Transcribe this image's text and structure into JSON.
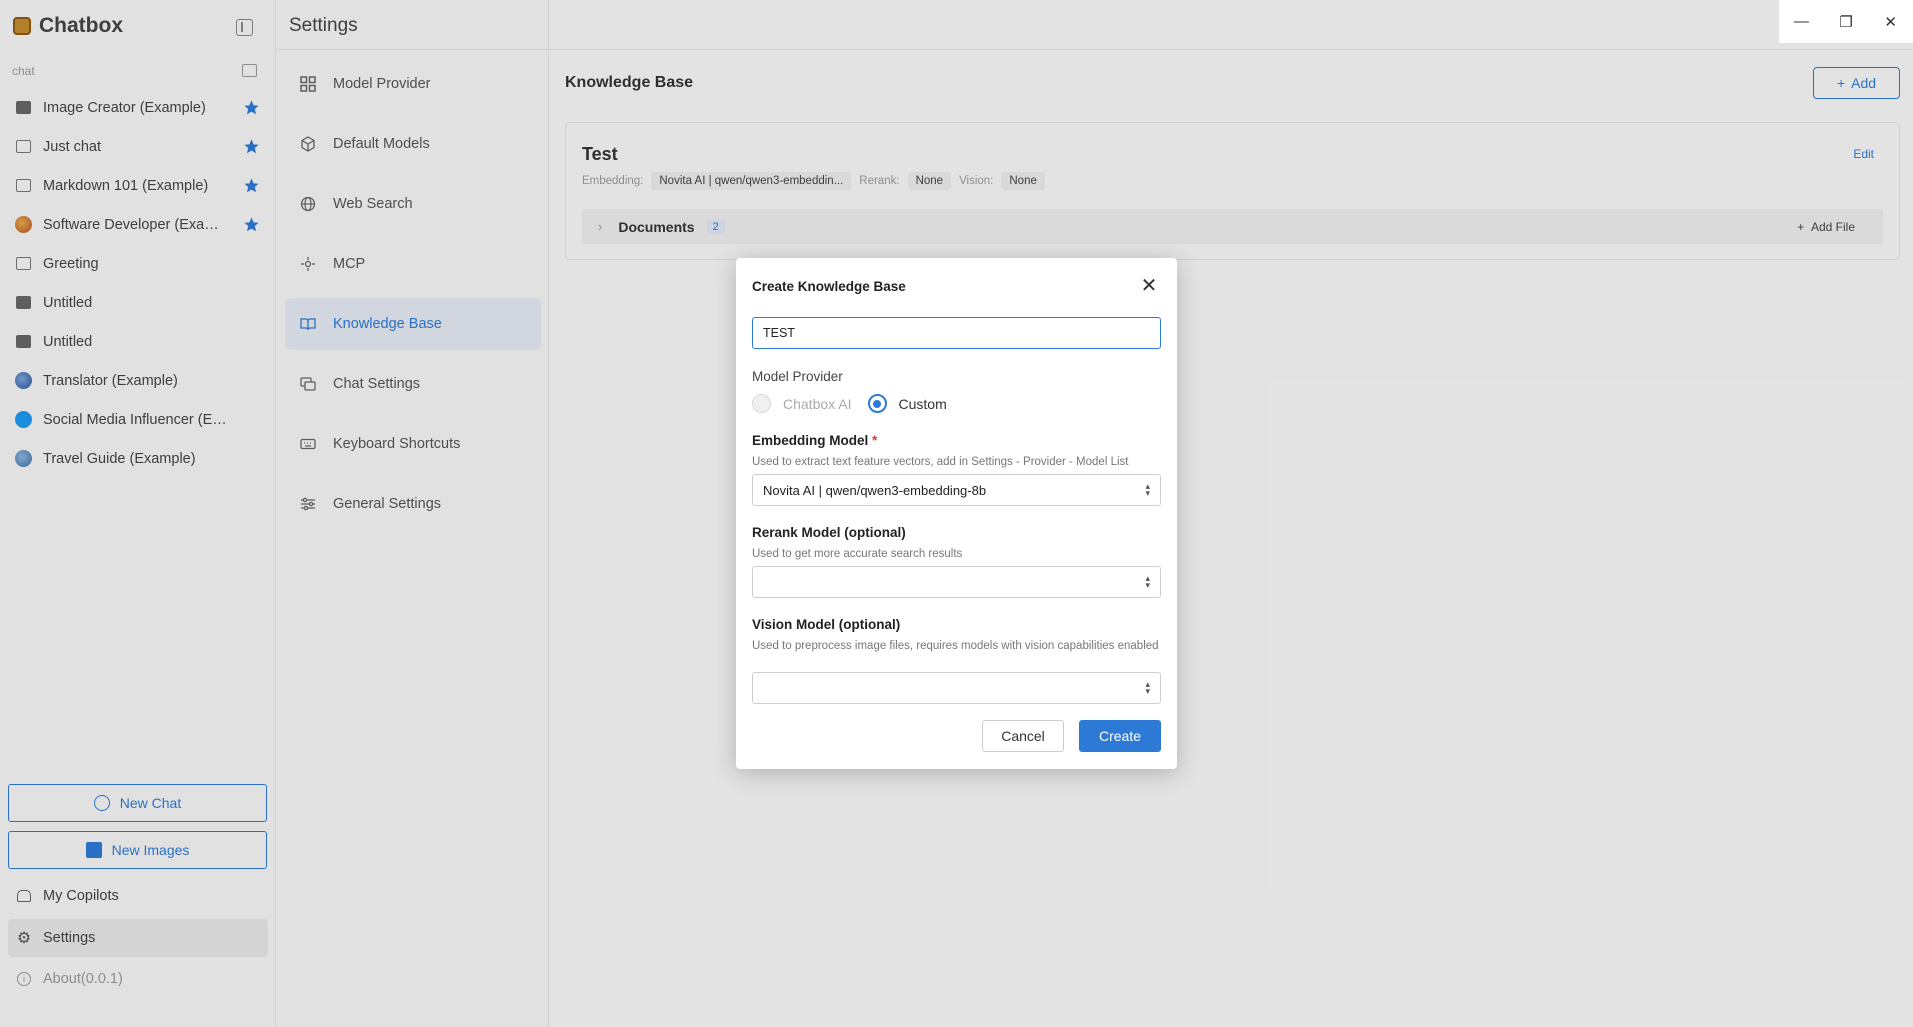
{
  "app": {
    "name": "Chatbox"
  },
  "sidebar": {
    "section_label": "chat",
    "chats": [
      {
        "label": "Image Creator (Example)",
        "icon": "image-icon",
        "starred": true
      },
      {
        "label": "Just chat",
        "icon": "message-icon",
        "starred": true
      },
      {
        "label": "Markdown 101 (Example)",
        "icon": "message-icon",
        "starred": true
      },
      {
        "label": "Software Developer (Exam...",
        "icon": "avatar-icon",
        "starred": true
      },
      {
        "label": "Greeting",
        "icon": "message-icon",
        "starred": false
      },
      {
        "label": "Untitled",
        "icon": "image-icon",
        "starred": false
      },
      {
        "label": "Untitled",
        "icon": "image-icon",
        "starred": false
      },
      {
        "label": "Translator (Example)",
        "icon": "avatar-icon",
        "starred": false
      },
      {
        "label": "Social Media Influencer (Example)",
        "icon": "twitter-icon",
        "starred": false
      },
      {
        "label": "Travel Guide (Example)",
        "icon": "globe-icon",
        "starred": false
      }
    ],
    "new_chat": "New Chat",
    "new_images": "New Images",
    "my_copilots": "My Copilots",
    "settings": "Settings",
    "about": "About(0.0.1)"
  },
  "settings": {
    "title": "Settings",
    "nav": [
      {
        "label": "Model Provider",
        "icon": "grid-icon"
      },
      {
        "label": "Default Models",
        "icon": "cube-icon"
      },
      {
        "label": "Web Search",
        "icon": "globe-icon"
      },
      {
        "label": "MCP",
        "icon": "mcp-icon"
      },
      {
        "label": "Knowledge Base",
        "icon": "book-icon",
        "active": true
      },
      {
        "label": "Chat Settings",
        "icon": "chat-settings-icon"
      },
      {
        "label": "Keyboard Shortcuts",
        "icon": "keyboard-icon"
      },
      {
        "label": "General Settings",
        "icon": "sliders-icon"
      }
    ]
  },
  "main": {
    "header": "Knowledge Base",
    "add_label": "Add",
    "kb": {
      "name": "Test",
      "edit_label": "Edit",
      "embedding_label": "Embedding:",
      "embedding_value": "Novita AI | qwen/qwen3-embeddin...",
      "rerank_label": "Rerank:",
      "rerank_value": "None",
      "vision_label": "Vision:",
      "vision_value": "None",
      "documents_label": "Documents",
      "documents_count": "2",
      "add_file_label": "Add File"
    }
  },
  "dialog": {
    "title": "Create Knowledge Base",
    "name_value": "TEST",
    "model_provider_label": "Model Provider",
    "provider_options": [
      "Chatbox AI",
      "Custom"
    ],
    "provider_selected": "Custom",
    "embedding_label": "Embedding Model",
    "embedding_required": "*",
    "embedding_help": "Used to extract text feature vectors, add in Settings - Provider - Model List",
    "embedding_value": "Novita AI | qwen/qwen3-embedding-8b",
    "rerank_label": "Rerank Model (optional)",
    "rerank_help": "Used to get more accurate search results",
    "rerank_value": "",
    "vision_label": "Vision Model (optional)",
    "vision_help": "Used to preprocess image files, requires models with vision capabilities enabled",
    "vision_value": "",
    "cancel_label": "Cancel",
    "create_label": "Create"
  },
  "colors": {
    "accent": "#2d7ad6",
    "required": "#e03b3b"
  }
}
